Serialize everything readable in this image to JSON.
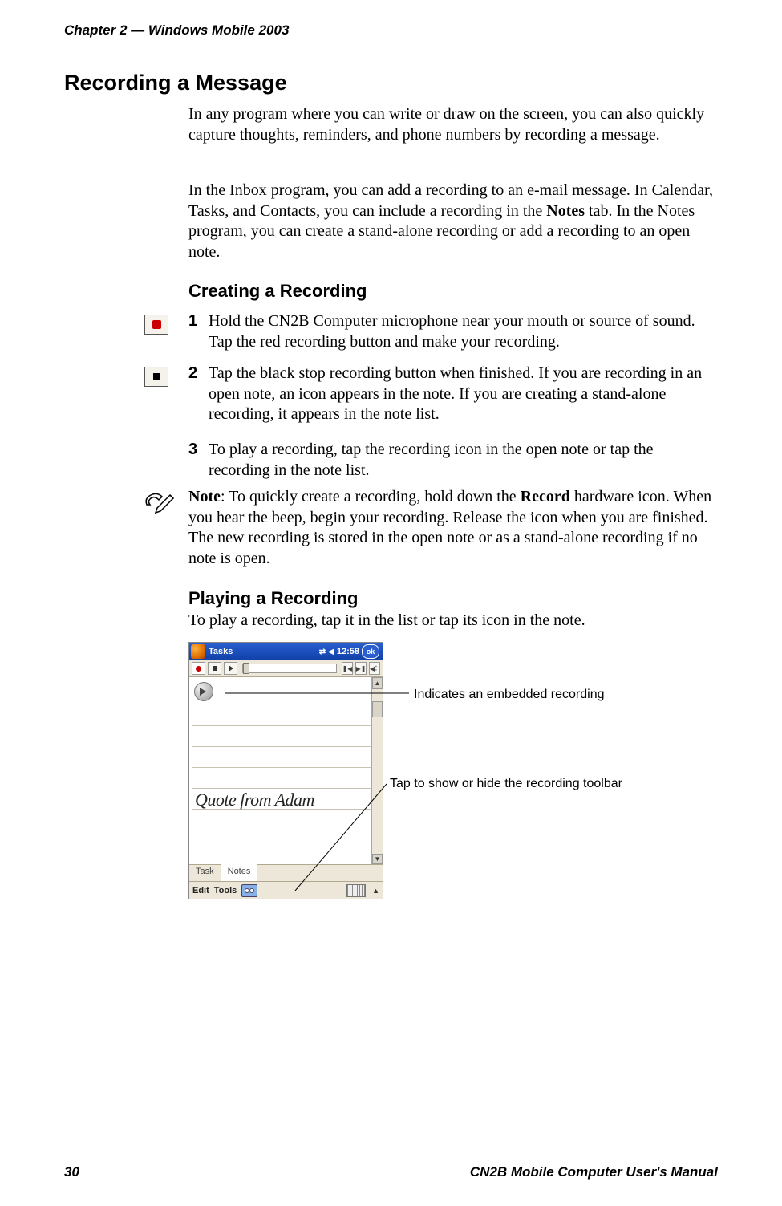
{
  "header": {
    "running_head": "Chapter 2 — Windows Mobile 2003"
  },
  "h1": "Recording a Message",
  "p1": "In any program where you can write or draw on the screen, you can also quickly capture thoughts, reminders, and phone numbers by recording a message.",
  "p2_a": "In the Inbox program, you can add a recording to an e-mail message. In Calendar, Tasks, and Contacts, you can include a recording in the ",
  "p2_bold": "Notes",
  "p2_b": " tab. In the Notes program, you can create a stand-alone recording or add a recording to an open note.",
  "h2_creating": "Creating a Recording",
  "steps": {
    "s1_num": "1",
    "s1_text": "Hold the CN2B Computer microphone near your mouth or source of sound. Tap the red recording button and make your recording.",
    "s2_num": "2",
    "s2_text": "Tap the black stop recording button when finished. If you are recording in an open note, an icon appears in the note. If you are creating a stand-alone recording, it appears in the note list.",
    "s3_num": "3",
    "s3_text": "To play a recording, tap the recording icon in the open note or tap the recording in the note list."
  },
  "note": {
    "label": "Note",
    "text_a": ": To quickly create a recording, hold down the ",
    "bold": "Record",
    "text_b": " hardware icon. When you hear the beep, begin your recording. Release the icon when you are finished. The new recording is stored in the open note or as a stand-alone recording if no note is open."
  },
  "h2_playing": "Playing a Recording",
  "playing_text": "To play a recording, tap it in the list or tap its icon in the note.",
  "screenshot": {
    "app_title": "Tasks",
    "time": "12:58",
    "ok": "ok",
    "handwriting": "Quote from Adam",
    "tab_task": "Task",
    "tab_notes": "Notes",
    "menu_edit": "Edit",
    "menu_tools": "Tools"
  },
  "callouts": {
    "c1": "Indicates an embedded recording",
    "c2": "Tap to show or hide the recording toolbar"
  },
  "footer": {
    "page_number": "30",
    "manual_title": "CN2B Mobile Computer User's Manual"
  }
}
